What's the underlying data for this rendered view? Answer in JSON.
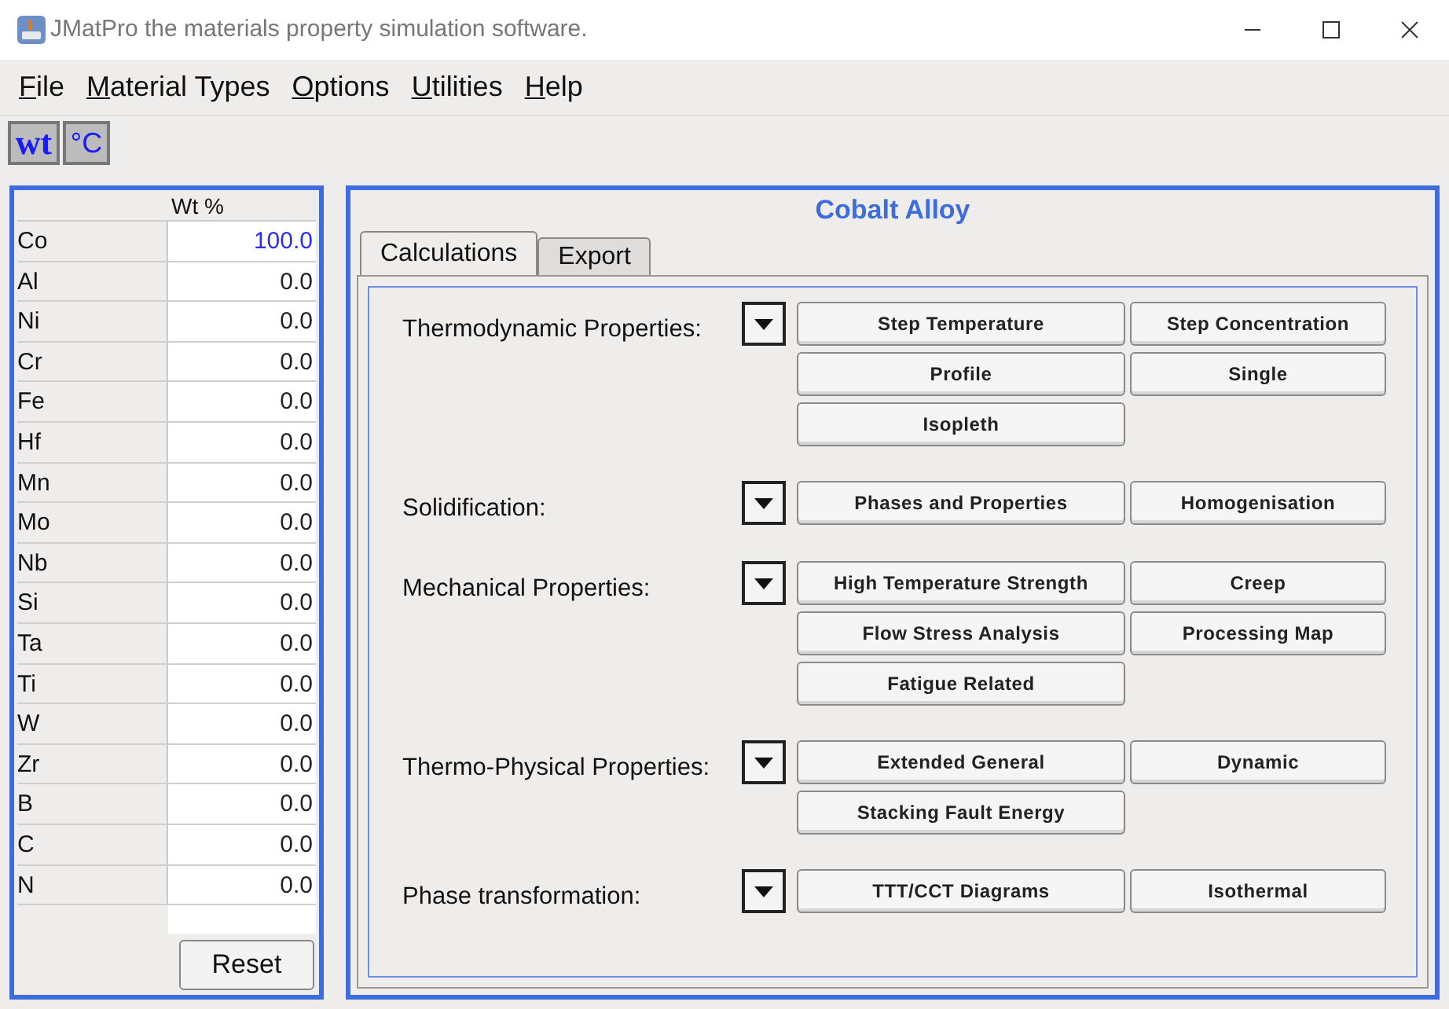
{
  "window": {
    "title": "JMatPro the materials property simulation software."
  },
  "menu": [
    "File",
    "Material Types",
    "Options",
    "Utilities",
    "Help"
  ],
  "toolbar": [
    "wt",
    "°C"
  ],
  "composition": {
    "header": "Wt %",
    "rows": [
      {
        "element": "Co",
        "value": "100.0",
        "kind": "balance"
      },
      {
        "element": "Al",
        "value": "0.0",
        "kind": "normal"
      },
      {
        "element": "Ni",
        "value": "0.0",
        "kind": "normal"
      },
      {
        "element": "Cr",
        "value": "0.0",
        "kind": "normal"
      },
      {
        "element": "Fe",
        "value": "0.0",
        "kind": "normal"
      },
      {
        "element": "Hf",
        "value": "0.0",
        "kind": "normal"
      },
      {
        "element": "Mn",
        "value": "0.0",
        "kind": "normal"
      },
      {
        "element": "Mo",
        "value": "0.0",
        "kind": "normal"
      },
      {
        "element": "Nb",
        "value": "0.0",
        "kind": "normal"
      },
      {
        "element": "Si",
        "value": "0.0",
        "kind": "normal"
      },
      {
        "element": "Ta",
        "value": "0.0",
        "kind": "normal"
      },
      {
        "element": "Ti",
        "value": "0.0",
        "kind": "normal"
      },
      {
        "element": "W",
        "value": "0.0",
        "kind": "normal"
      },
      {
        "element": "Zr",
        "value": "0.0",
        "kind": "normal"
      },
      {
        "element": "B",
        "value": "0.0",
        "kind": "normal"
      },
      {
        "element": "C",
        "value": "0.0",
        "kind": "normal"
      },
      {
        "element": "N",
        "value": "0.0",
        "kind": "normal"
      }
    ],
    "reset_button": "Reset"
  },
  "panel": {
    "title": "Cobalt Alloy",
    "tabs": [
      {
        "label": "Calculations",
        "selected": true
      },
      {
        "label": "Export",
        "selected": false
      }
    ],
    "sections": [
      {
        "label": "Thermodynamic Properties:",
        "buttons": [
          "Step Temperature",
          "Step Concentration",
          "Profile",
          "Single",
          "Isopleth"
        ]
      },
      {
        "label": "Solidification:",
        "buttons": [
          "Phases and Properties",
          "Homogenisation"
        ]
      },
      {
        "label": "Mechanical Properties:",
        "buttons": [
          "High Temperature Strength",
          "Creep",
          "Flow Stress Analysis",
          "Processing Map",
          "Fatigue Related"
        ]
      },
      {
        "label": "Thermo-Physical Properties:",
        "buttons": [
          "Extended General",
          "Dynamic",
          "Stacking Fault Energy"
        ]
      },
      {
        "label": "Phase transformation:",
        "buttons": [
          "TTT/CCT Diagrams",
          "Isothermal"
        ]
      }
    ]
  }
}
